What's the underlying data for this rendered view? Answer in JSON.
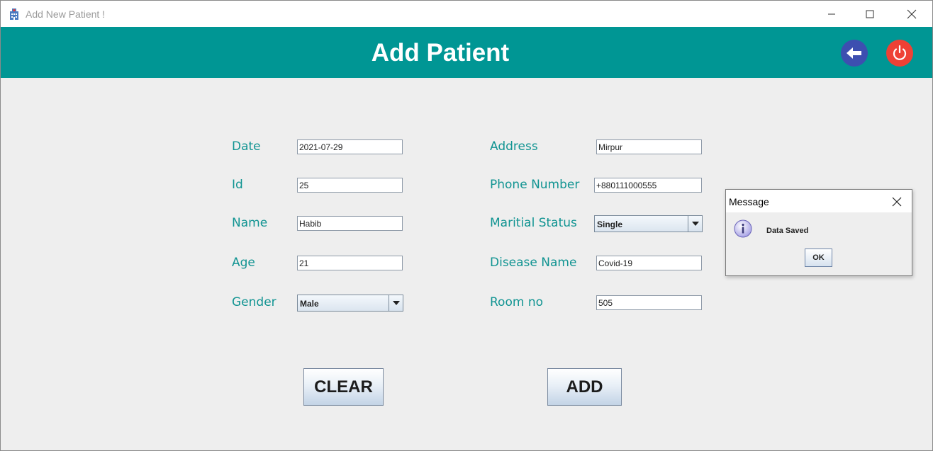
{
  "window": {
    "title": "Add New Patient !"
  },
  "header": {
    "title": "Add Patient"
  },
  "form": {
    "date_label": "Date",
    "date_value": "2021-07-29",
    "id_label": "Id",
    "id_value": "25",
    "name_label": "Name",
    "name_value": "Habib",
    "age_label": "Age",
    "age_value": "21",
    "gender_label": "Gender",
    "gender_selected": "Male",
    "address_label": "Address",
    "address_value": "Mirpur",
    "phone_label": "Phone Number",
    "phone_value": "+880111000555",
    "marital_label": "Maritial Status",
    "marital_selected": "Single",
    "disease_label": "Disease Name",
    "disease_value": "Covid-19",
    "room_label": "Room no",
    "room_value": "505"
  },
  "buttons": {
    "clear": "CLEAR",
    "add": "ADD"
  },
  "dialog": {
    "title": "Message",
    "message": "Data Saved",
    "ok": "OK"
  },
  "colors": {
    "header": "#009694",
    "label": "#119492",
    "back_button": "#3d4fb0",
    "power_button": "#ee4135"
  },
  "icons": {
    "app": "hospital-icon",
    "back": "arrow-left-icon",
    "power": "power-icon",
    "info": "info-icon"
  }
}
